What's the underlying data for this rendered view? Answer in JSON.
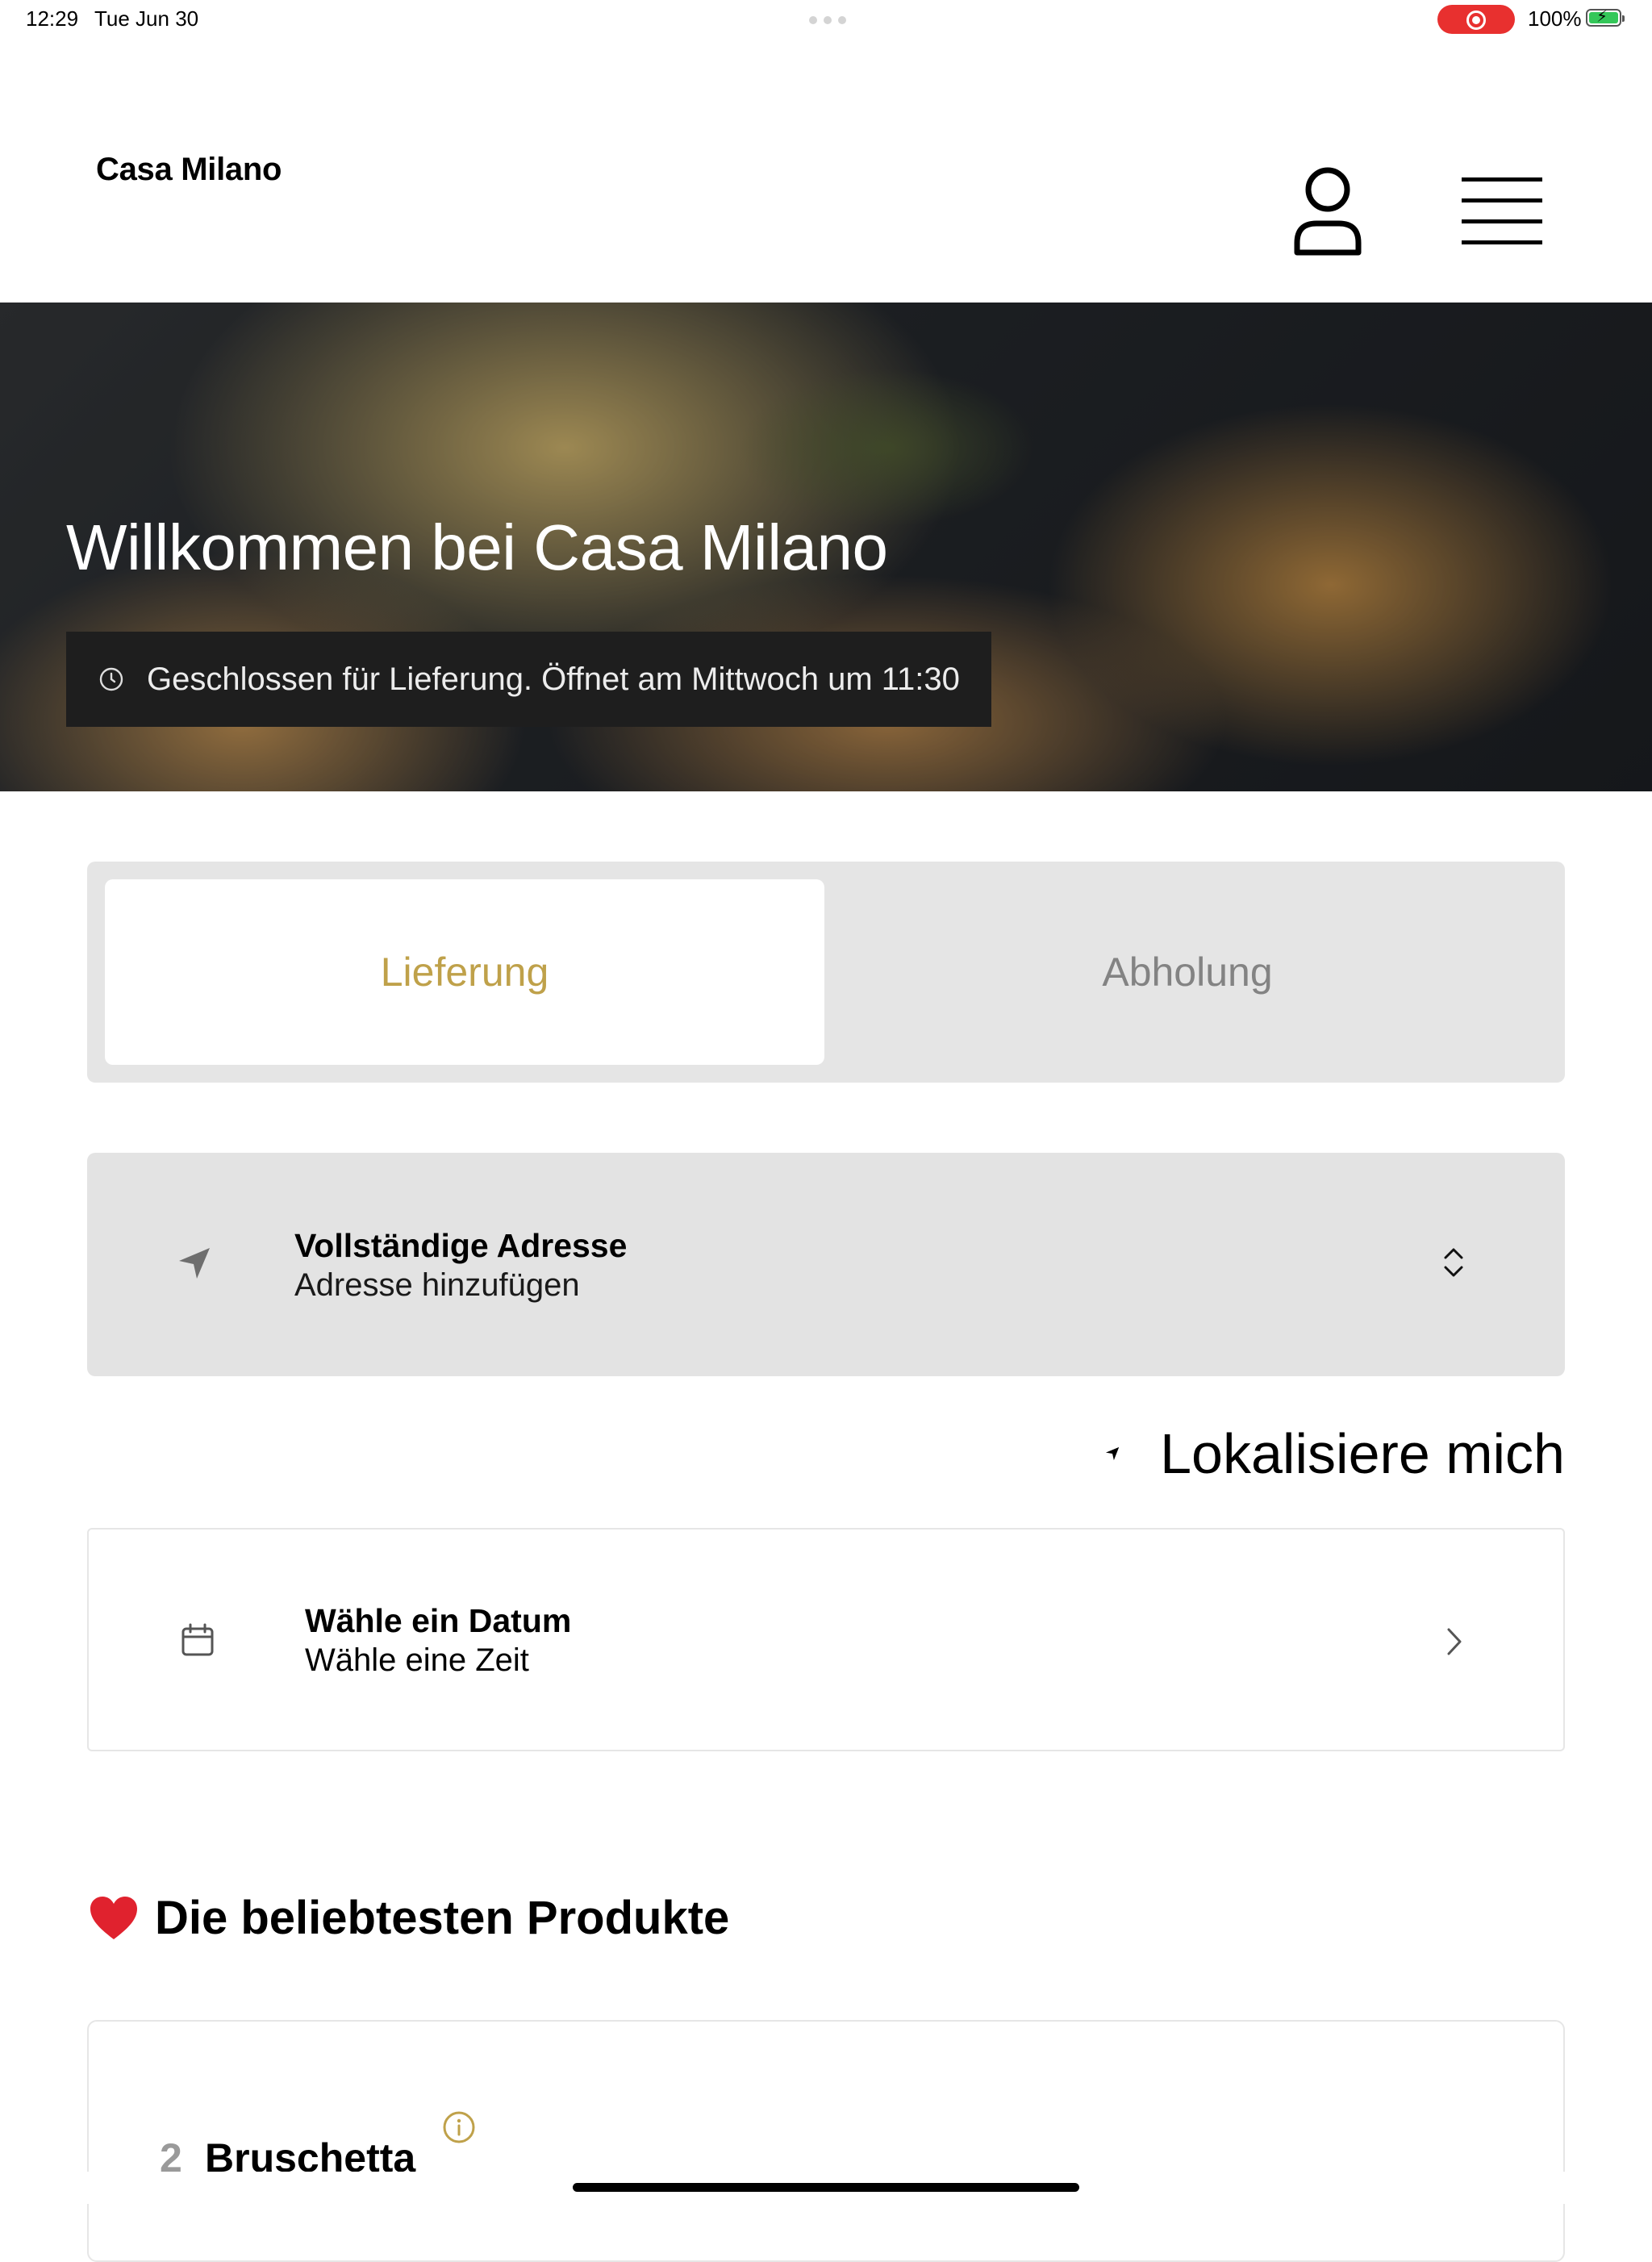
{
  "status_bar": {
    "time": "12:29",
    "date": "Tue Jun 30",
    "battery_percent": "100%",
    "battery_level": 1.0,
    "recording_active": true,
    "recording_color": "#e8302f",
    "battery_color": "#34c759"
  },
  "header": {
    "brand": "Casa Milano",
    "icons": [
      "user-icon",
      "hamburger-menu-icon"
    ]
  },
  "hero": {
    "title": "Willkommen bei Casa Milano",
    "status_text": "Geschlossen für Lieferung. Öffnet am Mittwoch um 11:30",
    "status_icon": "clock-icon"
  },
  "order_mode": {
    "options": [
      {
        "label": "Lieferung",
        "selected": true
      },
      {
        "label": "Abholung",
        "selected": false
      }
    ],
    "accent_color": "#bfa14a",
    "inactive_color": "#838383"
  },
  "address": {
    "title": "Vollständige Adresse",
    "subtitle": "Adresse hinzufügen",
    "icon": "navigation-arrow-icon",
    "control_icon": "chevron-up-down-icon"
  },
  "locate": {
    "label": "Lokalisiere mich",
    "icon": "location-arrow-icon"
  },
  "schedule": {
    "title": "Wähle ein Datum",
    "subtitle": "Wähle eine Zeit",
    "icon": "calendar-icon",
    "control_icon": "chevron-right-icon"
  },
  "popular": {
    "title": "Die beliebtesten Produkte",
    "title_icon": "heart-icon",
    "items": [
      {
        "rank": "2",
        "name": "Bruschetta",
        "icon": "info-icon"
      }
    ]
  }
}
